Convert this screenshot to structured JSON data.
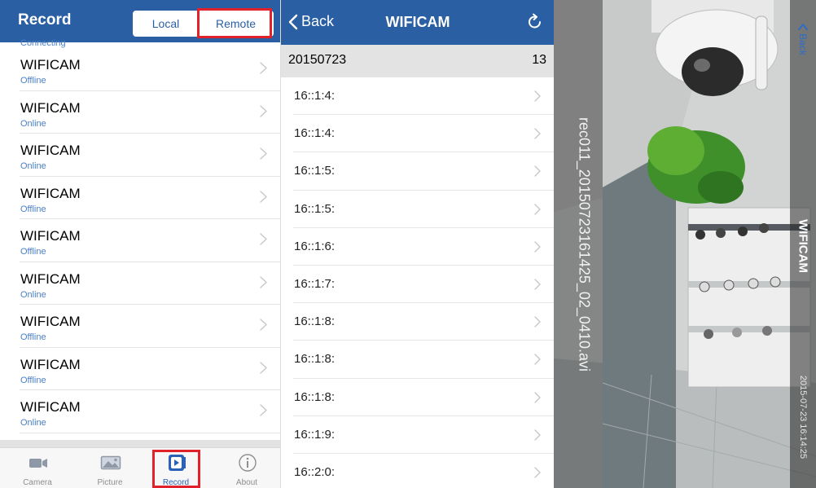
{
  "record_screen": {
    "title": "Record",
    "segments": {
      "local": "Local",
      "remote": "Remote"
    },
    "partial_status": "Connecting",
    "devices": [
      {
        "name": "WIFICAM",
        "status": "Offline"
      },
      {
        "name": "WIFICAM",
        "status": "Online"
      },
      {
        "name": "WIFICAM",
        "status": "Online"
      },
      {
        "name": "WIFICAM",
        "status": "Offline"
      },
      {
        "name": "WIFICAM",
        "status": "Offline"
      },
      {
        "name": "WIFICAM",
        "status": "Online"
      },
      {
        "name": "WIFICAM",
        "status": "Offline"
      },
      {
        "name": "WIFICAM",
        "status": "Offline"
      },
      {
        "name": "WIFICAM",
        "status": "Online"
      }
    ],
    "tabs": [
      {
        "label": "Camera",
        "icon": "camera-icon"
      },
      {
        "label": "Picture",
        "icon": "picture-icon"
      },
      {
        "label": "Record",
        "icon": "record-icon"
      },
      {
        "label": "About",
        "icon": "info-icon"
      }
    ],
    "active_tab": "Record"
  },
  "recordings_screen": {
    "back_label": "Back",
    "title": "WIFICAM",
    "date": "20150723",
    "count": "13",
    "items": [
      "16::1:4:",
      "16::1:4:",
      "16::1:5:",
      "16::1:5:",
      "16::1:6:",
      "16::1:7:",
      "16::1:8:",
      "16::1:8:",
      "16::1:8:",
      "16::1:9:",
      "16::2:0:"
    ]
  },
  "player_screen": {
    "file_name": "rec011_20150723161425_02_0410.avi",
    "camera_name": "WIFICAM",
    "back_label": "Back",
    "timestamp": "2015-07-23 16:14:25"
  },
  "colors": {
    "header_blue": "#2a5fa3",
    "status_blue": "#4a7fc7",
    "highlight_red": "#e2222a",
    "active_tab_blue": "#2a62ba"
  }
}
